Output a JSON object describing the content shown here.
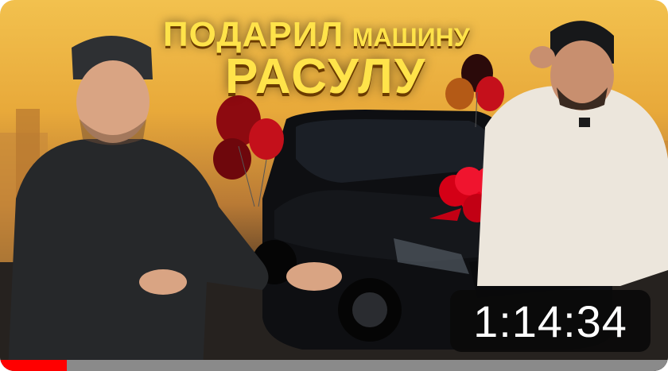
{
  "thumbnail": {
    "title_line1_big": "ПОДАРИЛ",
    "title_line1_small": "МАШИНУ",
    "title_line2": "РАСУЛУ",
    "duration": "1:14:34",
    "watched_progress": 0.1,
    "colors": {
      "title_text": "#ffe34a",
      "progress_watched": "#ff0000",
      "progress_track": "#8a8a8a",
      "duration_badge_bg": "#0a0a0a"
    },
    "icons": [
      "red-balloon-icon",
      "gift-bow-icon"
    ]
  }
}
